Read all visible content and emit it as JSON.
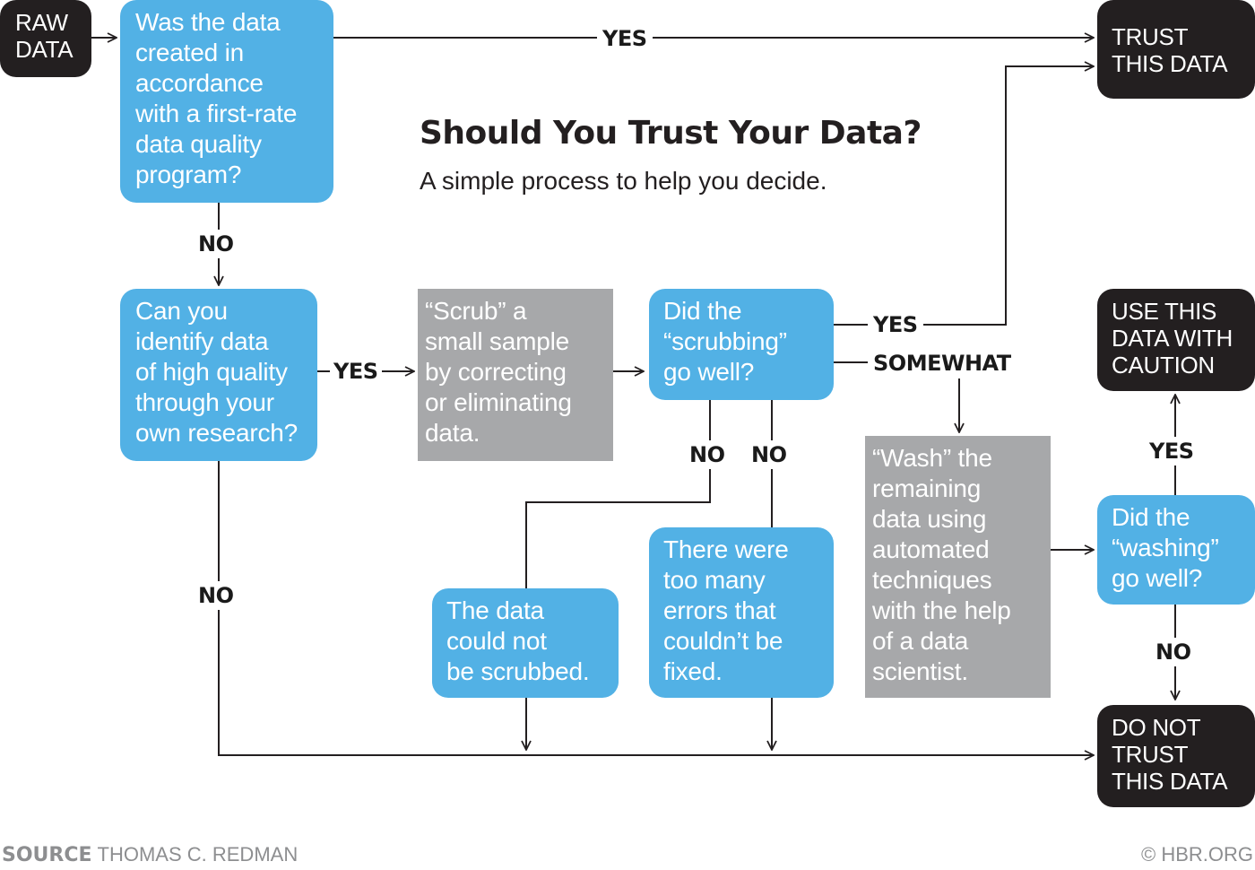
{
  "title": "Should You Trust Your Data?",
  "subtitle": "A simple process to help you decide.",
  "nodes": {
    "raw_data": "RAW\nDATA",
    "q_created": "Was the data\ncreated in\naccordance\nwith a first-rate\ndata quality\nprogram?",
    "q_identify": "Can you\nidentify data\nof high quality\nthrough your\nown research?",
    "scrub": "“Scrub” a\nsmall sample\nby correcting\nor eliminating\ndata.",
    "q_scrub_well": "Did the\n“scrubbing”\ngo well?",
    "not_scrubbed": "The data\ncould not\nbe scrubbed.",
    "too_many_errors": "There were\ntoo many\nerrors that\ncouldn’t be\nfixed.",
    "wash": "“Wash” the\nremaining\ndata using\nautomated\ntechniques\nwith the help\nof a data\nscientist.",
    "q_wash_well": "Did the\n“washing”\ngo well?",
    "trust": "TRUST\nTHIS DATA",
    "caution": "USE THIS\nDATA WITH\nCAUTION",
    "do_not_trust": "DO NOT\nTRUST\nTHIS DATA"
  },
  "edge_labels": {
    "created_yes": "YES",
    "created_no": "NO",
    "identify_yes": "YES",
    "identify_no": "NO",
    "scrub_yes": "YES",
    "scrub_somewhat": "SOMEWHAT",
    "scrub_no_1": "NO",
    "scrub_no_2": "NO",
    "wash_yes": "YES",
    "wash_no": "NO"
  },
  "footer": {
    "source_label": "SOURCE",
    "source_value": "THOMAS C. REDMAN",
    "copyright": "© HBR.ORG"
  },
  "colors": {
    "question_blue": "#52b1e5",
    "process_gray": "#a7a8aa",
    "terminal_black": "#231f20",
    "line": "#231f20"
  }
}
